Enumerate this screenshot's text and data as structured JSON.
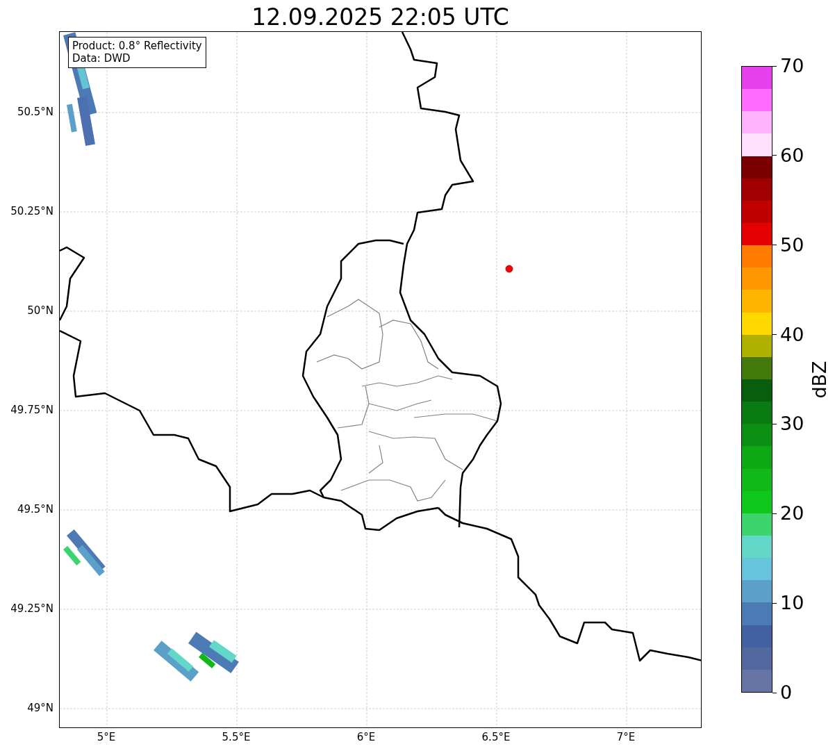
{
  "title": "12.09.2025 22:05 UTC",
  "map": {
    "info_lines": [
      "Product: 0.8° Reflectivity",
      "Data: DWD"
    ],
    "lat_ticks": [
      "50.5°N",
      "50.25°N",
      "50°N",
      "49.75°N",
      "49.5°N",
      "49.25°N",
      "49°N"
    ],
    "lon_ticks": [
      "5°E",
      "5.5°E",
      "6°E",
      "6.5°E",
      "7°E"
    ]
  },
  "colorbar": {
    "label": "dBZ",
    "ticks": [
      "70",
      "60",
      "50",
      "40",
      "30",
      "20",
      "10",
      "0"
    ],
    "bands": [
      {
        "color": "#e840ec"
      },
      {
        "color": "#ff6cff"
      },
      {
        "color": "#ffb4ff"
      },
      {
        "color": "#ffe0ff"
      },
      {
        "color": "#7a0000"
      },
      {
        "color": "#a00000"
      },
      {
        "color": "#c00000"
      },
      {
        "color": "#e40000"
      },
      {
        "color": "#ff7c00"
      },
      {
        "color": "#ff9800"
      },
      {
        "color": "#ffb400"
      },
      {
        "color": "#ffd800"
      },
      {
        "color": "#b0b000"
      },
      {
        "color": "#447a0c"
      },
      {
        "color": "#085e0c"
      },
      {
        "color": "#0a7a12"
      },
      {
        "color": "#0c9014"
      },
      {
        "color": "#0ea814"
      },
      {
        "color": "#10b818"
      },
      {
        "color": "#10c81c"
      },
      {
        "color": "#3cd46c"
      },
      {
        "color": "#64d8c8"
      },
      {
        "color": "#68c4dc"
      },
      {
        "color": "#5aa0c8"
      },
      {
        "color": "#4c7ab4"
      },
      {
        "color": "#4360a0"
      },
      {
        "color": "#5468a0"
      },
      {
        "color": "#6675a6"
      }
    ]
  }
}
